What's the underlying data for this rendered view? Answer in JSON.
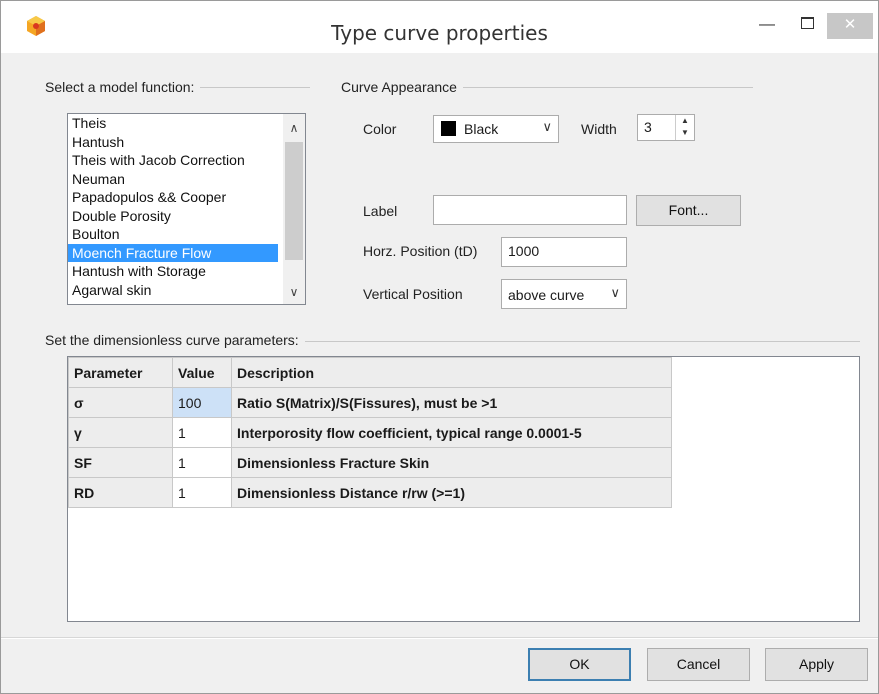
{
  "window": {
    "title": "Type curve properties",
    "buttons": {
      "minimize": "—",
      "maximize": "",
      "close": "✕"
    }
  },
  "model_group": {
    "label": "Select a model function:",
    "items": [
      {
        "label": "Theis"
      },
      {
        "label": "Hantush"
      },
      {
        "label": "Theis with Jacob Correction"
      },
      {
        "label": "Neuman"
      },
      {
        "label": "Papadopulos && Cooper"
      },
      {
        "label": "Double Porosity"
      },
      {
        "label": "Boulton"
      },
      {
        "label": "Moench Fracture Flow",
        "selected": true
      },
      {
        "label": "Hantush with Storage"
      },
      {
        "label": "Agarwal skin"
      }
    ]
  },
  "appearance": {
    "label": "Curve Appearance",
    "color_label": "Color",
    "color_value": "Black",
    "color_hex": "#000000",
    "width_label": "Width",
    "width_value": "3",
    "label_label": "Label",
    "label_value": "",
    "font_button": "Font...",
    "horz_label": "Horz. Position (tD)",
    "horz_value": "1000",
    "vert_label": "Vertical Position",
    "vert_value": "above curve"
  },
  "params": {
    "label": "Set the dimensionless curve parameters:",
    "headers": [
      "Parameter",
      "Value",
      "Description"
    ],
    "rows": [
      {
        "param": "σ",
        "value": "100",
        "desc": "Ratio S(Matrix)/S(Fissures), must be >1"
      },
      {
        "param": "γ",
        "value": "1",
        "desc": "Interporosity flow coefficient, typical range 0.0001-5"
      },
      {
        "param": "SF",
        "value": "1",
        "desc": "Dimensionless Fracture Skin"
      },
      {
        "param": "RD",
        "value": "1",
        "desc": "Dimensionless Distance r/rw (>=1)"
      }
    ]
  },
  "footer": {
    "ok": "OK",
    "cancel": "Cancel",
    "apply": "Apply"
  },
  "colors": {
    "selection": "#3399ff",
    "active_cell": "#cde1f7",
    "close_button": "#c7c7c7"
  }
}
